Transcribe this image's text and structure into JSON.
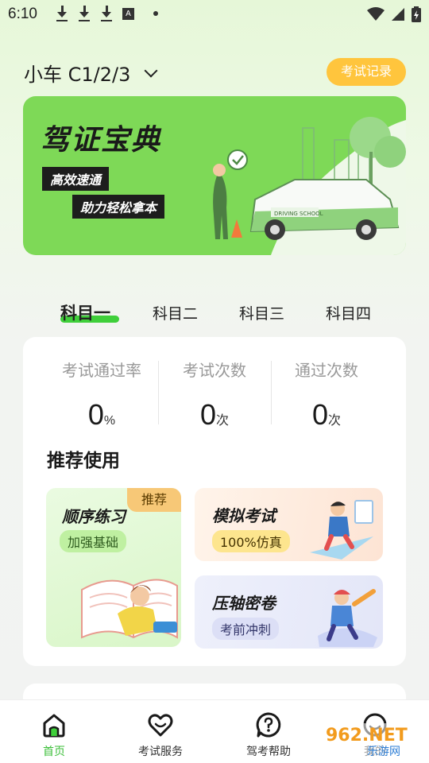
{
  "status_bar": {
    "time": "6:10",
    "notif_letter": "A"
  },
  "header": {
    "car_type": "小车 C1/2/3",
    "exam_record_button": "考试记录"
  },
  "banner": {
    "title": "驾证宝典",
    "tags": [
      "高效速通",
      "助力轻松拿本"
    ],
    "car_sign": "DRIVING SCHOOL"
  },
  "tabs": [
    "科目一",
    "科目二",
    "科目三",
    "科目四"
  ],
  "stats": [
    {
      "label": "考试通过率",
      "value": "0",
      "unit": "%"
    },
    {
      "label": "考试次数",
      "value": "0",
      "unit": "次"
    },
    {
      "label": "通过次数",
      "value": "0",
      "unit": "次"
    }
  ],
  "recommend": {
    "title": "推荐使用",
    "sequential": {
      "title": "顺序练习",
      "tag": "加强基础",
      "badge": "推荐"
    },
    "mock": {
      "title": "模拟考试",
      "tag": "100%仿真"
    },
    "final": {
      "title": "压轴密卷",
      "tag": "考前冲刺"
    }
  },
  "bottom_nav": [
    {
      "label": "首页",
      "icon": "home-icon",
      "active": true
    },
    {
      "label": "考试服务",
      "icon": "heart-icon",
      "active": false
    },
    {
      "label": "驾考帮助",
      "icon": "help-icon",
      "active": false
    },
    {
      "label": "我的",
      "icon": "smile-icon",
      "active": false
    }
  ],
  "watermark": {
    "main": "962.NET",
    "sub": "乐游网"
  },
  "colors": {
    "accent_green": "#3fcf3a",
    "banner_green": "#7ed957",
    "record_yellow": "#ffc53d"
  }
}
